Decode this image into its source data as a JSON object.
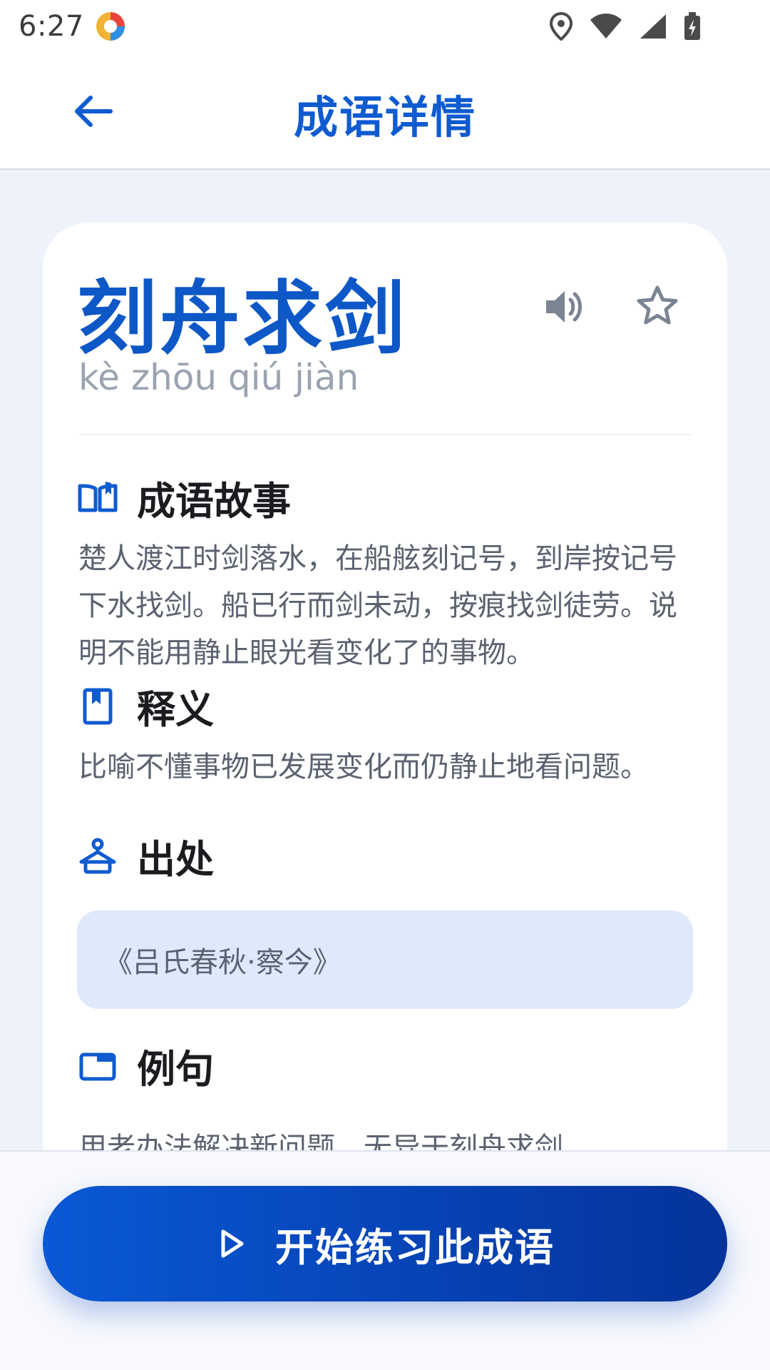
{
  "status_bar": {
    "time": "6:27"
  },
  "app_bar": {
    "title": "成语详情"
  },
  "idiom": {
    "title": "刻舟求剑",
    "pinyin": "kè zhōu qiú jiàn"
  },
  "sections": {
    "story": {
      "title": "成语故事",
      "text": "楚人渡江时剑落水，在船舷刻记号，到岸按记号下水找剑。船已行而剑未动，按痕找剑徒劳。说明不能用静止眼光看变化了的事物。"
    },
    "meaning": {
      "title": "释义",
      "text": "比喻不懂事物已发展变化而仍静止地看问题。"
    },
    "source": {
      "title": "出处",
      "text": "《吕氏春秋·察今》"
    },
    "example": {
      "title": "例句",
      "text": "用老办法解决新问题，无异于刻舟求剑。"
    }
  },
  "cta": {
    "label": "开始练习此成语"
  },
  "colors": {
    "primary": "#0f5bd0",
    "source_bg": "#dfe9fc"
  },
  "icons": [
    "back-arrow-icon",
    "volume-icon",
    "star-icon",
    "book-open-icon",
    "bookmark-icon",
    "hanger-icon",
    "folder-icon",
    "play-icon"
  ]
}
